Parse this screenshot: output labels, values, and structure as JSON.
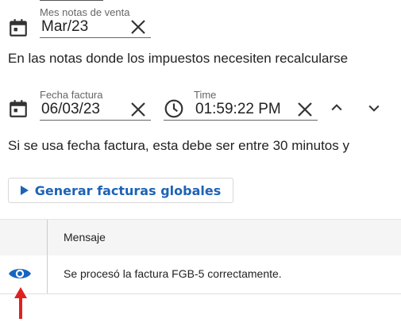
{
  "mes_notas": {
    "label": "Mes notas de venta",
    "value": "Mar/23",
    "icon": "calendar-icon",
    "clear_icon": "close-icon"
  },
  "paragraph1": "En las notas donde los impuestos necesiten recalcularse",
  "fecha_factura": {
    "label": "Fecha factura",
    "value": "06/03/23",
    "icon": "calendar-icon",
    "clear_icon": "close-icon"
  },
  "time": {
    "label": "Time",
    "value": "01:59:22 PM",
    "icon": "clock-icon",
    "clear_icon": "close-icon",
    "up_icon": "chevron-up-icon",
    "down_icon": "chevron-down-icon"
  },
  "paragraph2": "Si se usa fecha factura, esta debe ser entre 30 minutos y",
  "generate_button": {
    "label": "Generar facturas globales",
    "icon": "play-icon"
  },
  "table": {
    "headers": [
      "",
      "Mensaje"
    ],
    "rows": [
      {
        "icon": "eye-icon",
        "message": "Se procesó la factura FGB-5 correctamente."
      }
    ]
  },
  "colors": {
    "accent": "#1e63b6",
    "eye": "#1565c0",
    "arrow": "#e02020"
  }
}
